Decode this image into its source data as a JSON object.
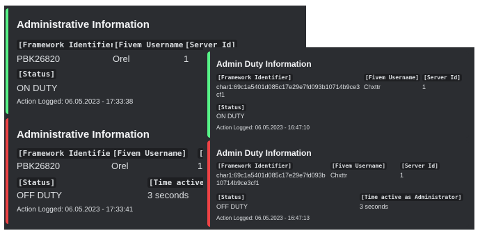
{
  "big_panel": {
    "embeds": [
      {
        "accent": "#57f287",
        "title": "Administrative Information",
        "labels": {
          "framework": "[Framework Identifier]",
          "fivem": "[Fivem Username]",
          "server": "[Server Id]",
          "status": "[Status]"
        },
        "values": {
          "framework": "PBK26820",
          "fivem": "Orel",
          "server": "1",
          "status": "ON DUTY"
        },
        "footer": "Action Logged: 06.05.2023 - 17:33:38"
      },
      {
        "accent": "#ed4245",
        "title": "Administrative Information",
        "labels": {
          "framework": "[Framework Identifier]",
          "fivem": "[Fivem Username]",
          "server": "[S",
          "status": "[Status]",
          "time": "[Time active a"
        },
        "values": {
          "framework": "PBK26820",
          "fivem": "Orel",
          "server": "1",
          "status": "OFF DUTY",
          "time": "3 seconds"
        },
        "footer": "Action Logged: 06.05.2023 - 17:33:41"
      }
    ]
  },
  "small_panel": {
    "embeds": [
      {
        "accent": "#57f287",
        "title": "Admin Duty Information",
        "labels": {
          "framework": "[Framework Identifier]",
          "fivem": "[Fivem Username]",
          "server": "[Server Id]",
          "status": "[Status]"
        },
        "values": {
          "framework": "char1:69c1a5401d085c17e29e7fd093b10714b9ce3cf1",
          "fivem": "Chxttr",
          "server": "1",
          "status": "ON DUTY"
        },
        "footer": "Action Logged: 06.05.2023 - 16:47:10"
      },
      {
        "accent": "#ed4245",
        "title": "Admin Duty Information",
        "labels": {
          "framework": "[Framework Identifier]",
          "fivem": "[Fivem Username]",
          "server": "[Server Id]",
          "status": "[Status]",
          "time": "[Time active as Administrator]"
        },
        "values": {
          "framework": "char1:69c1a5401d085c17e29e7fd093b10714b9ce3cf1",
          "fivem": "Chxttr",
          "server": "1",
          "status": "OFF DUTY",
          "time": "3 seconds"
        },
        "footer": "Action Logged: 06.05.2023 - 16:47:13"
      }
    ]
  }
}
